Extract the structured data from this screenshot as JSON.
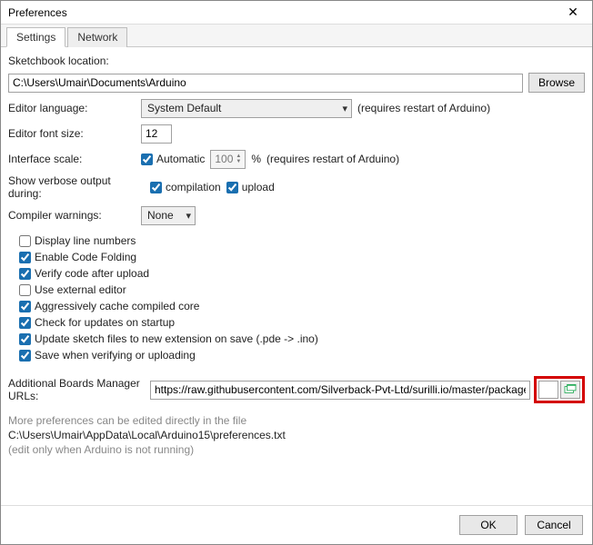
{
  "window": {
    "title": "Preferences"
  },
  "tabs": {
    "settings": "Settings",
    "network": "Network"
  },
  "sketchbook": {
    "label": "Sketchbook location:",
    "value": "C:\\Users\\Umair\\Documents\\Arduino",
    "browse": "Browse"
  },
  "editor_language": {
    "label": "Editor language:",
    "value": "System Default",
    "hint": "(requires restart of Arduino)"
  },
  "editor_font_size": {
    "label": "Editor font size:",
    "value": "12"
  },
  "interface_scale": {
    "label": "Interface scale:",
    "automatic_label": "Automatic",
    "percent_value": "100",
    "percent_sign": "%",
    "hint": "(requires restart of Arduino)"
  },
  "verbose": {
    "label": "Show verbose output during:",
    "compilation": "compilation",
    "upload": "upload"
  },
  "compiler_warnings": {
    "label": "Compiler warnings:",
    "value": "None"
  },
  "checks": {
    "display_line_numbers": "Display line numbers",
    "enable_code_folding": "Enable Code Folding",
    "verify_after_upload": "Verify code after upload",
    "use_external_editor": "Use external editor",
    "aggressively_cache": "Aggressively cache compiled core",
    "check_updates": "Check for updates on startup",
    "update_sketch_ext": "Update sketch files to new extension on save (.pde -> .ino)",
    "save_when_verifying": "Save when verifying or uploading"
  },
  "additional_urls": {
    "label": "Additional Boards Manager URLs:",
    "value": "https://raw.githubusercontent.com/Silverback-Pvt-Ltd/surilli.io/master/package_surilli.io_index.json"
  },
  "footnotes": {
    "more_prefs": "More preferences can be edited directly in the file",
    "path": "C:\\Users\\Umair\\AppData\\Local\\Arduino15\\preferences.txt",
    "edit_only": "(edit only when Arduino is not running)"
  },
  "buttons": {
    "ok": "OK",
    "cancel": "Cancel"
  }
}
